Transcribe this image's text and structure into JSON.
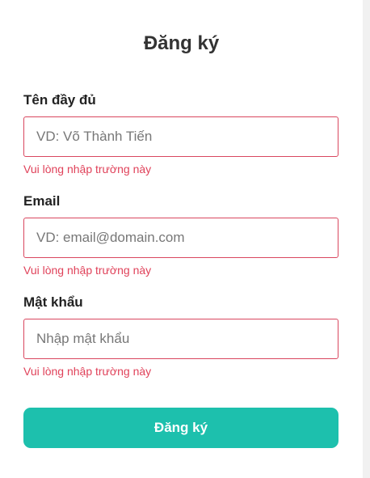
{
  "form": {
    "title": "Đăng ký",
    "fields": [
      {
        "label": "Tên đầy đủ",
        "placeholder": "VD: Võ Thành Tiến",
        "value": "",
        "error": "Vui lòng nhập trường này"
      },
      {
        "label": "Email",
        "placeholder": "VD: email@domain.com",
        "value": "",
        "error": "Vui lòng nhập trường này"
      },
      {
        "label": "Mật khẩu",
        "placeholder": "Nhập mật khẩu",
        "value": "",
        "error": "Vui lòng nhập trường này"
      }
    ],
    "submit_label": "Đăng ký"
  },
  "colors": {
    "accent": "#1dc0ad",
    "error": "#e0425a",
    "error_border": "#d9475f",
    "text": "#333333"
  }
}
